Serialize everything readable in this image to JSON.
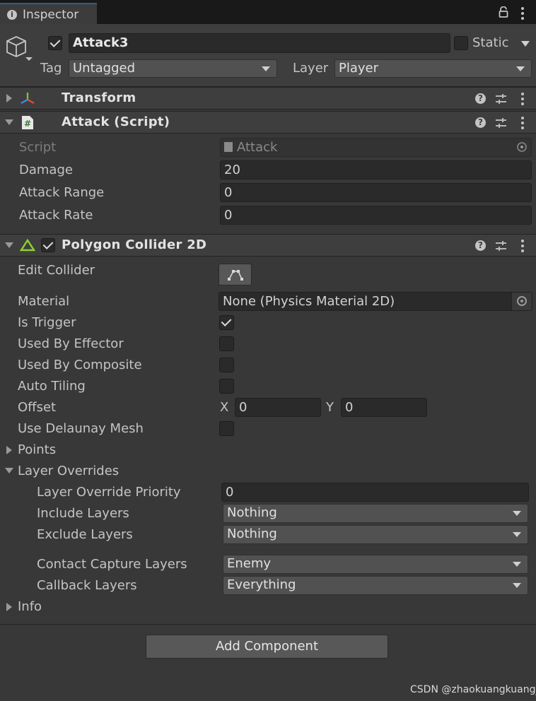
{
  "tab": {
    "title": "Inspector"
  },
  "header": {
    "object_name": "Attack3",
    "active": true,
    "static_label": "Static",
    "static_checked": false,
    "tag_label": "Tag",
    "tag_value": "Untagged",
    "layer_label": "Layer",
    "layer_value": "Player"
  },
  "components": {
    "transform": {
      "title": "Transform"
    },
    "attack": {
      "title": "Attack (Script)",
      "script_label": "Script",
      "script_value": "Attack",
      "damage_label": "Damage",
      "damage_value": "20",
      "range_label": "Attack Range",
      "range_value": "0",
      "rate_label": "Attack Rate",
      "rate_value": "0"
    },
    "collider": {
      "title": "Polygon Collider 2D",
      "enabled": true,
      "edit_collider_label": "Edit Collider",
      "material_label": "Material",
      "material_value": "None (Physics Material 2D)",
      "is_trigger_label": "Is Trigger",
      "is_trigger": true,
      "used_by_effector_label": "Used By Effector",
      "used_by_composite_label": "Used By Composite",
      "auto_tiling_label": "Auto Tiling",
      "offset_label": "Offset",
      "offset_x_label": "X",
      "offset_x": "0",
      "offset_y_label": "Y",
      "offset_y": "0",
      "delaunay_label": "Use Delaunay Mesh",
      "points_label": "Points",
      "layer_overrides_label": "Layer Overrides",
      "override_priority_label": "Layer Override Priority",
      "override_priority_value": "0",
      "include_layers_label": "Include Layers",
      "include_layers_value": "Nothing",
      "exclude_layers_label": "Exclude Layers",
      "exclude_layers_value": "Nothing",
      "contact_capture_label": "Contact Capture Layers",
      "contact_capture_value": "Enemy",
      "callback_layers_label": "Callback Layers",
      "callback_layers_value": "Everything",
      "info_label": "Info"
    }
  },
  "add_component_label": "Add Component",
  "watermark": "CSDN @zhaokuangkuang_"
}
